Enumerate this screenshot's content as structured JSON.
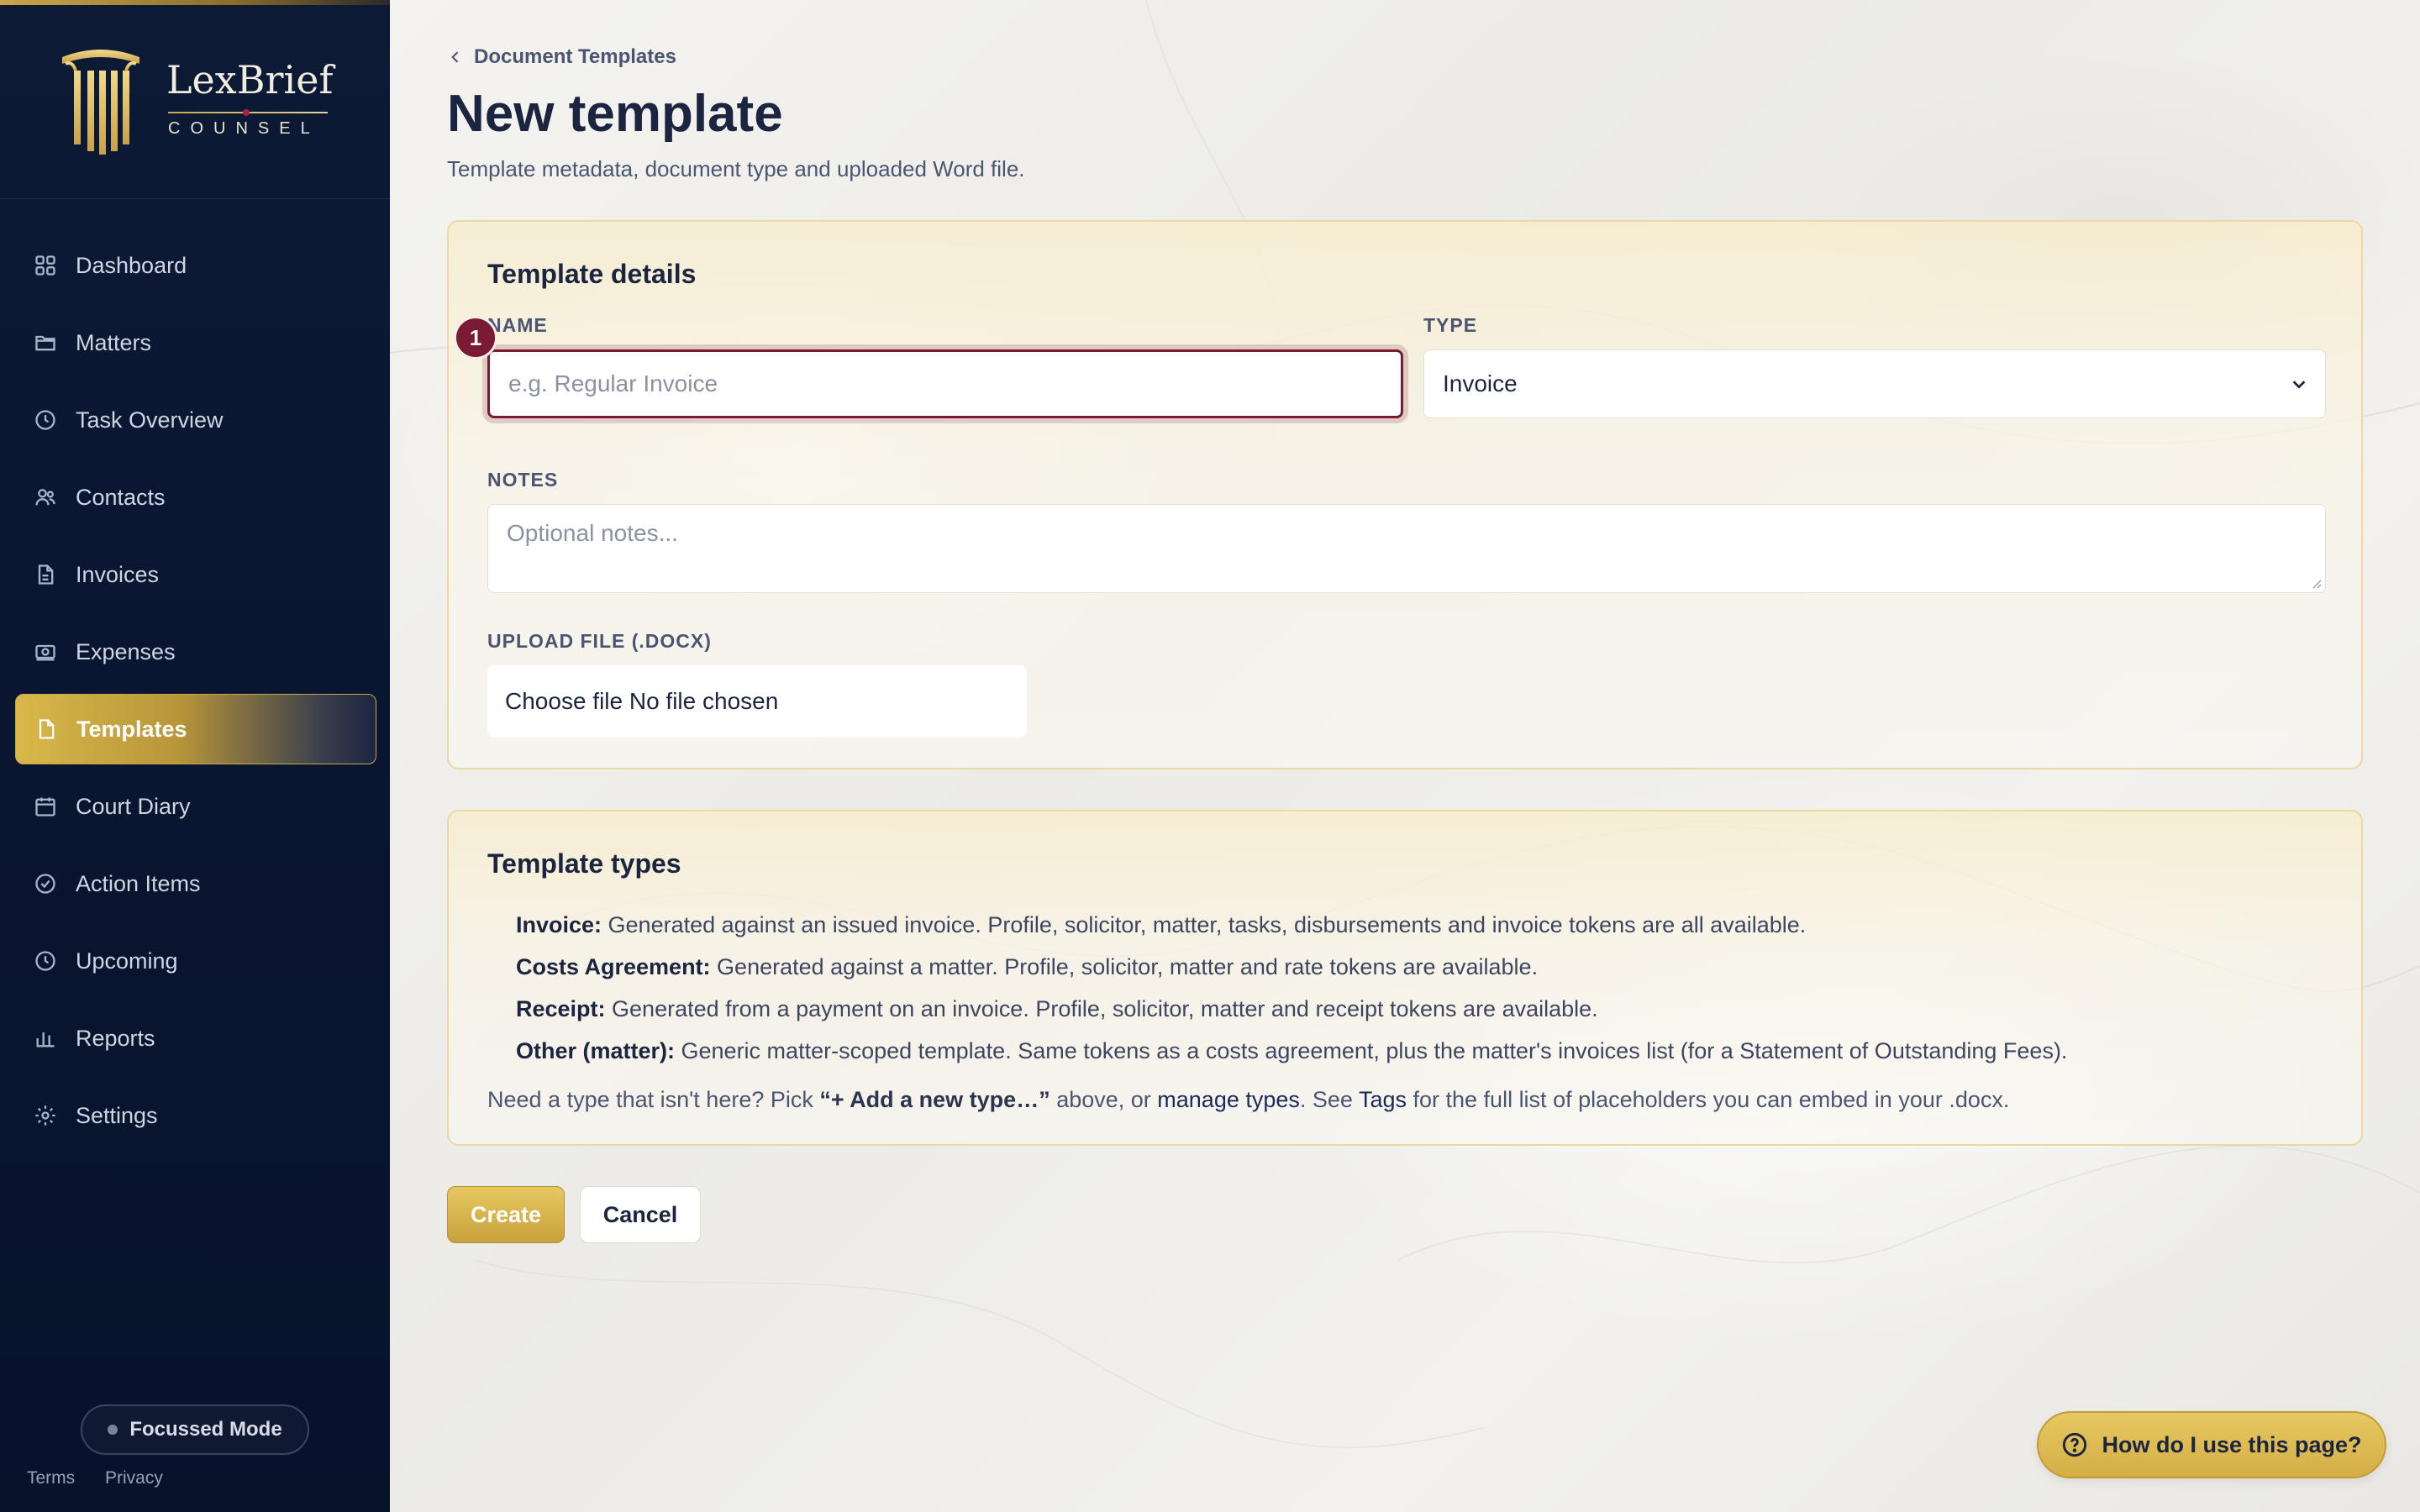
{
  "brand": {
    "name": "LexBrief",
    "sub": "COUNSEL"
  },
  "sidebar": {
    "items": [
      {
        "label": "Dashboard",
        "icon": "grid-icon"
      },
      {
        "label": "Matters",
        "icon": "folder-icon"
      },
      {
        "label": "Task Overview",
        "icon": "clock-icon"
      },
      {
        "label": "Contacts",
        "icon": "users-icon"
      },
      {
        "label": "Invoices",
        "icon": "file-icon"
      },
      {
        "label": "Expenses",
        "icon": "money-icon"
      },
      {
        "label": "Templates",
        "icon": "document-icon",
        "active": true
      },
      {
        "label": "Court Diary",
        "icon": "calendar-icon"
      },
      {
        "label": "Action Items",
        "icon": "check-circle-icon"
      },
      {
        "label": "Upcoming",
        "icon": "clock-icon"
      },
      {
        "label": "Reports",
        "icon": "bar-chart-icon"
      },
      {
        "label": "Settings",
        "icon": "gear-icon"
      }
    ],
    "focus_mode": "Focussed Mode",
    "terms": "Terms",
    "privacy": "Privacy"
  },
  "header": {
    "breadcrumb": "Document Templates",
    "title": "New template",
    "subtitle": "Template metadata, document type and uploaded Word file."
  },
  "details": {
    "title": "Template details",
    "name_label": "NAME",
    "name_placeholder": "e.g. Regular Invoice",
    "type_label": "TYPE",
    "type_value": "Invoice",
    "notes_label": "NOTES",
    "notes_placeholder": "Optional notes...",
    "upload_label": "UPLOAD FILE (.DOCX)",
    "upload_value": "Choose file No file chosen",
    "step_badge": "1"
  },
  "types": {
    "title": "Template types",
    "items": [
      {
        "name": "Invoice:",
        "desc": " Generated against an issued invoice. Profile, solicitor, matter, tasks, disbursements and invoice tokens are all available."
      },
      {
        "name": "Costs Agreement:",
        "desc": " Generated against a matter. Profile, solicitor, matter and rate tokens are available."
      },
      {
        "name": "Receipt:",
        "desc": " Generated from a payment on an invoice. Profile, solicitor, matter and receipt tokens are available."
      },
      {
        "name": "Other (matter):",
        "desc": " Generic matter-scoped template. Same tokens as a costs agreement, plus the matter's invoices list (for a Statement of Outstanding Fees)."
      }
    ],
    "foot_pre": "Need a type that isn't here? Pick ",
    "foot_bold": "“+ Add a new type…”",
    "foot_mid": " above, or ",
    "foot_link1": "manage types",
    "foot_mid2": ". See ",
    "foot_link2": "Tags",
    "foot_post": " for the full list of placeholders you can embed in your .docx."
  },
  "actions": {
    "create": "Create",
    "cancel": "Cancel"
  },
  "help": {
    "label": "How do I use this page?"
  },
  "colors": {
    "accent_gold": "#d4ae45",
    "sidebar_navy": "#0d1a36",
    "focus_maroon": "#7a1a34"
  }
}
